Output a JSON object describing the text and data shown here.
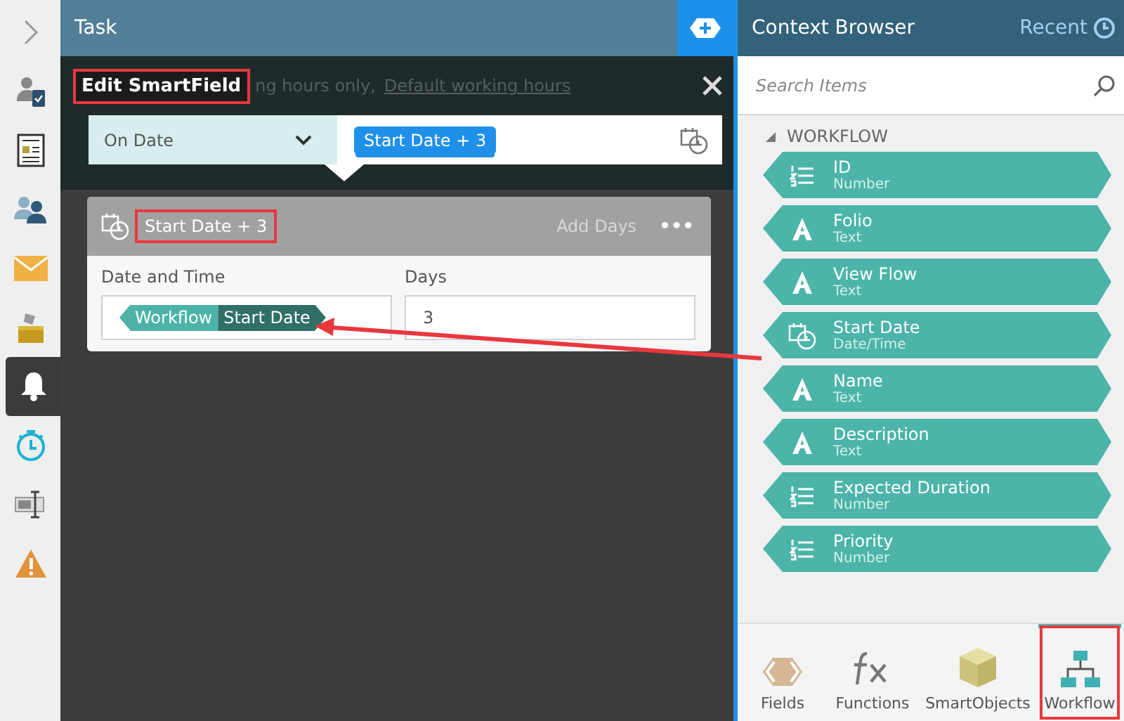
{
  "sidebar": {
    "items": [
      {
        "selected": false
      },
      {
        "selected": false
      },
      {
        "selected": false
      },
      {
        "selected": false
      },
      {
        "selected": false
      },
      {
        "selected": false
      },
      {
        "selected": true
      },
      {
        "selected": false
      },
      {
        "selected": false
      },
      {
        "selected": false
      }
    ]
  },
  "task": {
    "title": "Task"
  },
  "dialog": {
    "title": "Edit SmartField",
    "title_highlighted": true,
    "background_text": "ng hours only,",
    "background_link": "Default working hours",
    "mode": "On Date",
    "expression_token": "Start Date + 3",
    "card": {
      "title": "Start Date + 3",
      "title_highlighted": true,
      "action": "Add Days",
      "more": "•••",
      "fields": [
        {
          "label": "Date and Time",
          "kind": "token",
          "tokens": [
            {
              "text": "Workflow"
            },
            {
              "text": "Start Date"
            }
          ]
        },
        {
          "label": "Days",
          "kind": "text",
          "value": "3"
        }
      ]
    }
  },
  "context_browser": {
    "title": "Context Browser",
    "recent": "Recent",
    "search": {
      "placeholder": "Search Items"
    },
    "section": "WORKFLOW",
    "expanded": true,
    "items": [
      {
        "name": "ID",
        "type": "Number",
        "kind": "number"
      },
      {
        "name": "Folio",
        "type": "Text",
        "kind": "text"
      },
      {
        "name": "View Flow",
        "type": "Text",
        "kind": "text"
      },
      {
        "name": "Start Date",
        "type": "Date/Time",
        "kind": "date"
      },
      {
        "name": "Name",
        "type": "Text",
        "kind": "text"
      },
      {
        "name": "Description",
        "type": "Text",
        "kind": "text"
      },
      {
        "name": "Expected Duration",
        "type": "Number",
        "kind": "number"
      },
      {
        "name": "Priority",
        "type": "Number",
        "kind": "number"
      }
    ],
    "tabs": [
      {
        "label": "Fields",
        "selected": false,
        "highlighted": false
      },
      {
        "label": "Functions",
        "selected": false,
        "highlighted": false
      },
      {
        "label": "SmartObjects",
        "selected": false,
        "highlighted": false
      },
      {
        "label": "Workflow",
        "selected": true,
        "highlighted": true
      }
    ]
  }
}
